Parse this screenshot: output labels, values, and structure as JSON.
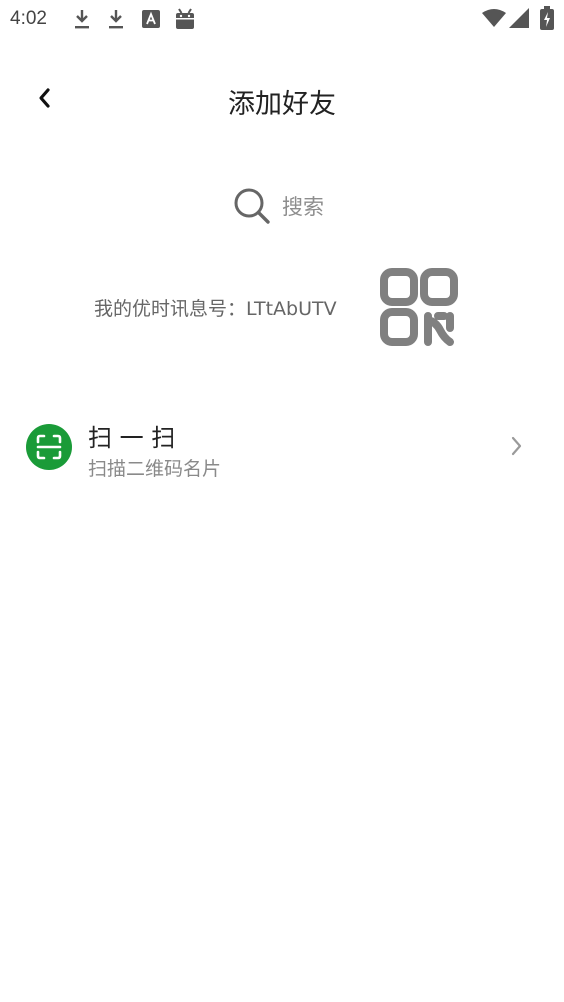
{
  "status_bar": {
    "time": "4:02",
    "icons": [
      "download-icon",
      "download-icon",
      "font-a-icon",
      "android-icon",
      "wifi-icon",
      "signal-icon",
      "battery-charging-icon"
    ]
  },
  "header": {
    "title": "添加好友",
    "back_icon": "chevron-left-icon"
  },
  "search": {
    "placeholder": "搜索",
    "icon": "search-icon"
  },
  "my_id": {
    "text": "我的优时讯息号：LTtAbUTV",
    "qr_icon": "qr-code-icon"
  },
  "scan": {
    "title": "扫 一 扫",
    "subtitle": "扫描二维码名片",
    "icon": "scan-icon",
    "accent_color": "#1a9b38"
  }
}
